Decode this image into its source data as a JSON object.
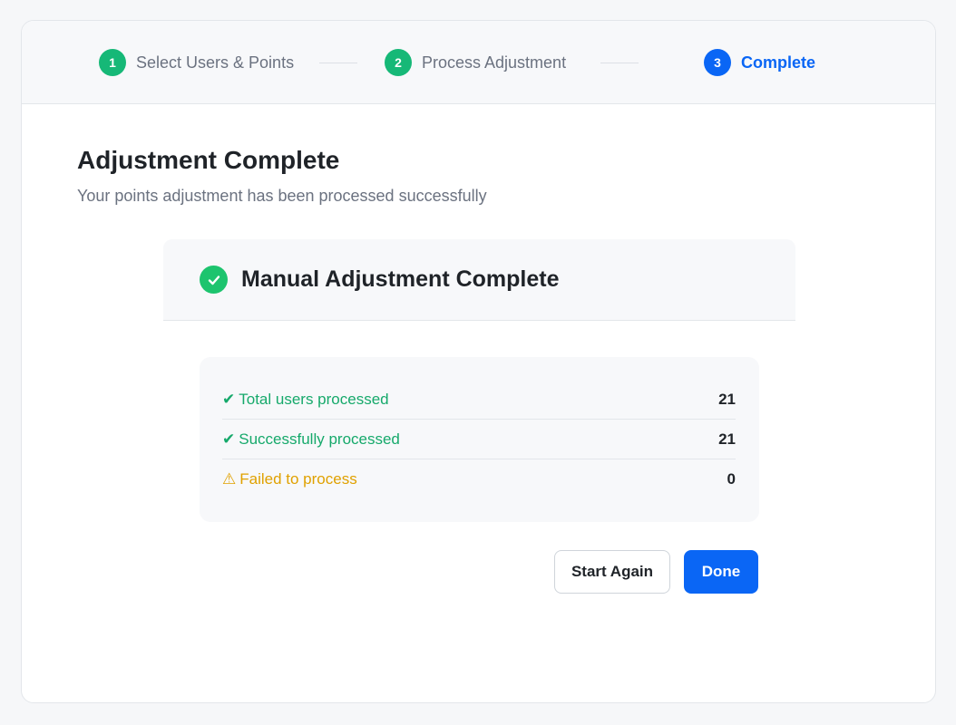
{
  "stepper": {
    "steps": [
      {
        "number": "1",
        "label": "Select Users & Points",
        "state": "done"
      },
      {
        "number": "2",
        "label": "Process Adjustment",
        "state": "done"
      },
      {
        "number": "3",
        "label": "Complete",
        "state": "active"
      }
    ]
  },
  "header": {
    "title": "Adjustment Complete",
    "subtitle": "Your points adjustment has been processed successfully"
  },
  "result": {
    "icon": "check-circle-icon",
    "title": "Manual Adjustment Complete"
  },
  "stats": [
    {
      "icon": "✔",
      "label": "Total users processed",
      "value": "21",
      "status": "success"
    },
    {
      "icon": "✔",
      "label": "Successfully processed",
      "value": "21",
      "status": "success"
    },
    {
      "icon": "⚠",
      "label": "Failed to process",
      "value": "0",
      "status": "warning"
    }
  ],
  "actions": {
    "start_again_label": "Start Again",
    "done_label": "Done"
  },
  "colors": {
    "accent": "#0a66f5",
    "success": "#16b877",
    "warning": "#e0a100"
  }
}
